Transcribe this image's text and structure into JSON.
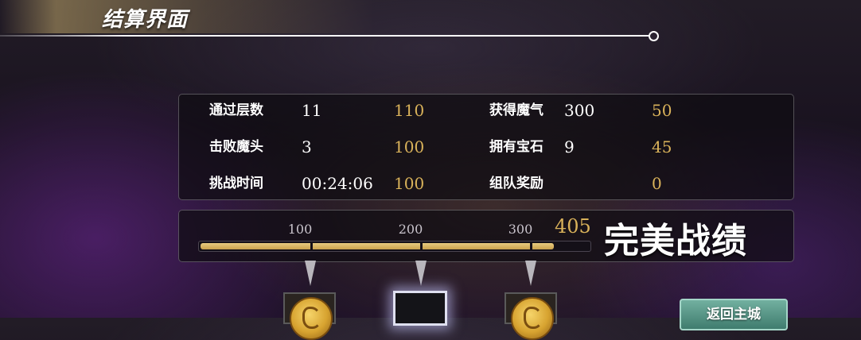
{
  "header": {
    "title": "结算界面"
  },
  "stats": {
    "left": [
      {
        "label": "通过层数",
        "value": "11",
        "score": "110"
      },
      {
        "label": "击败魔头",
        "value": "3",
        "score": "100"
      },
      {
        "label": "挑战时间",
        "value": "00:24:06",
        "score": "100"
      }
    ],
    "right": [
      {
        "label": "获得魔气",
        "value": "300",
        "score": "50"
      },
      {
        "label": "拥有宝石",
        "value": "9",
        "score": "45"
      },
      {
        "label": "组队奖励",
        "value": "",
        "score": "0"
      }
    ]
  },
  "progress": {
    "ticks": [
      "100",
      "200",
      "300"
    ],
    "total": "405",
    "grade": "完美战绩",
    "fill_fraction": 0.91
  },
  "rewards": [
    {
      "icon": "gold-coin-icon",
      "state": "unlocked"
    },
    {
      "icon": "empty-slot",
      "state": "selected"
    },
    {
      "icon": "gold-coin-icon",
      "state": "unlocked"
    }
  ],
  "actions": {
    "return_label": "返回主城"
  },
  "colors": {
    "score": "#d9b25a",
    "button": "#5a9888"
  }
}
